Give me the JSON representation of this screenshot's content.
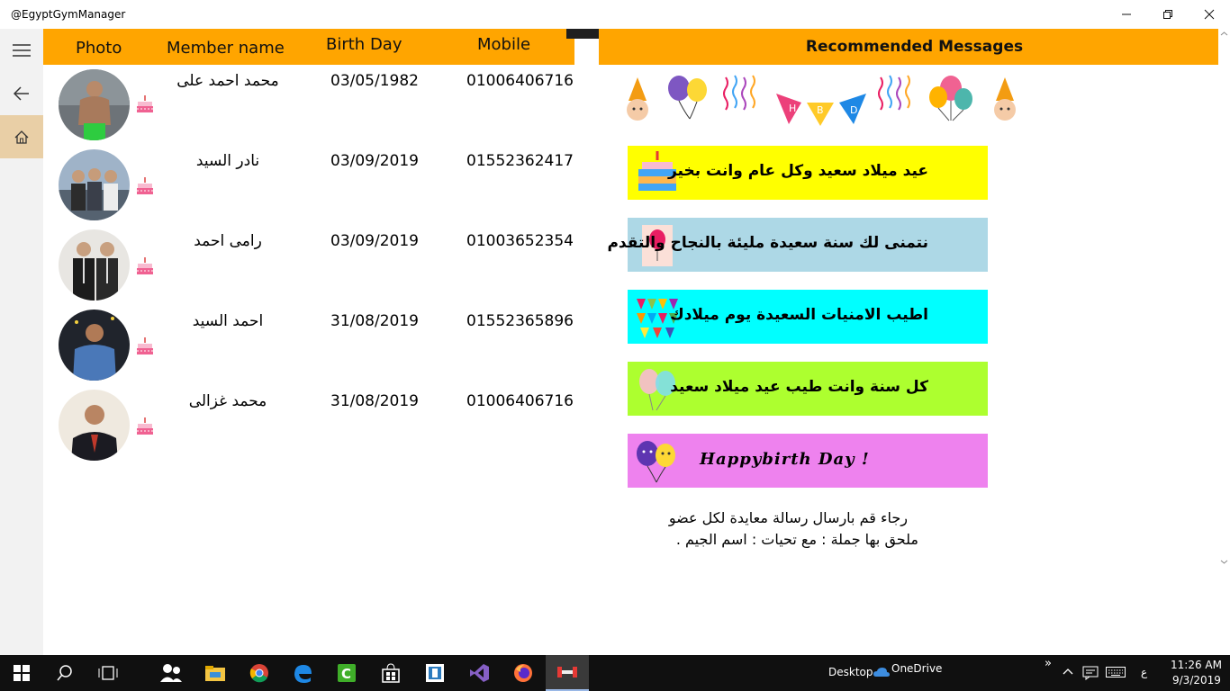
{
  "window": {
    "title": "@EgyptGymManager"
  },
  "table": {
    "headers": {
      "photo": "Photo",
      "name": "Member name",
      "birthday": "Birth Day",
      "mobile": "Mobile"
    },
    "rows": [
      {
        "name": "محمد احمد على",
        "birthday": "03/05/1982",
        "mobile": "01006406716"
      },
      {
        "name": "نادر السيد",
        "birthday": "03/09/2019",
        "mobile": "01552362417"
      },
      {
        "name": "رامى احمد",
        "birthday": "03/09/2019",
        "mobile": "01003652354"
      },
      {
        "name": "احمد السيد",
        "birthday": "31/08/2019",
        "mobile": "01552365896"
      },
      {
        "name": "محمد غزالى",
        "birthday": "31/08/2019",
        "mobile": "01006406716"
      }
    ]
  },
  "messages": {
    "header": "Recommended Messages",
    "banner_letters": [
      "H",
      "B",
      "D"
    ],
    "items": [
      {
        "text": "عيد ميلاد سعيد وكل عام وانت بخير",
        "bg": "#ffff00",
        "icon": "cake-icon"
      },
      {
        "text": "نتمنى لك سنة سعيدة مليئة بالنجاح والتقدم",
        "bg": "#add8e6",
        "icon": "balloon-card-icon"
      },
      {
        "text": "اطيب الامنيات السعيدة يوم ميلادك",
        "bg": "#00ffff",
        "icon": "bunting-icon"
      },
      {
        "text": "كل سنة وانت طيب عيد ميلاد سعيد",
        "bg": "#adff2f",
        "icon": "balloons-icon"
      },
      {
        "text": "Happybirth Day  !",
        "bg": "#ee82ee",
        "icon": "smiley-balloons-icon"
      }
    ],
    "note_line1": "رجاء قم بارسال رسالة معايدة لكل عضو",
    "note_line2": "ملحق بها جملة : مع تحيات : اسم الجيم ."
  },
  "taskbar": {
    "desktop_label": "Desktop",
    "onedrive_label": "OneDrive",
    "input_indicator": "ع",
    "time": "11:26 AM",
    "date": "9/3/2019",
    "chevron": "»"
  },
  "colors": {
    "accent": "#ffa500",
    "nav_active": "#e9cfa6"
  }
}
